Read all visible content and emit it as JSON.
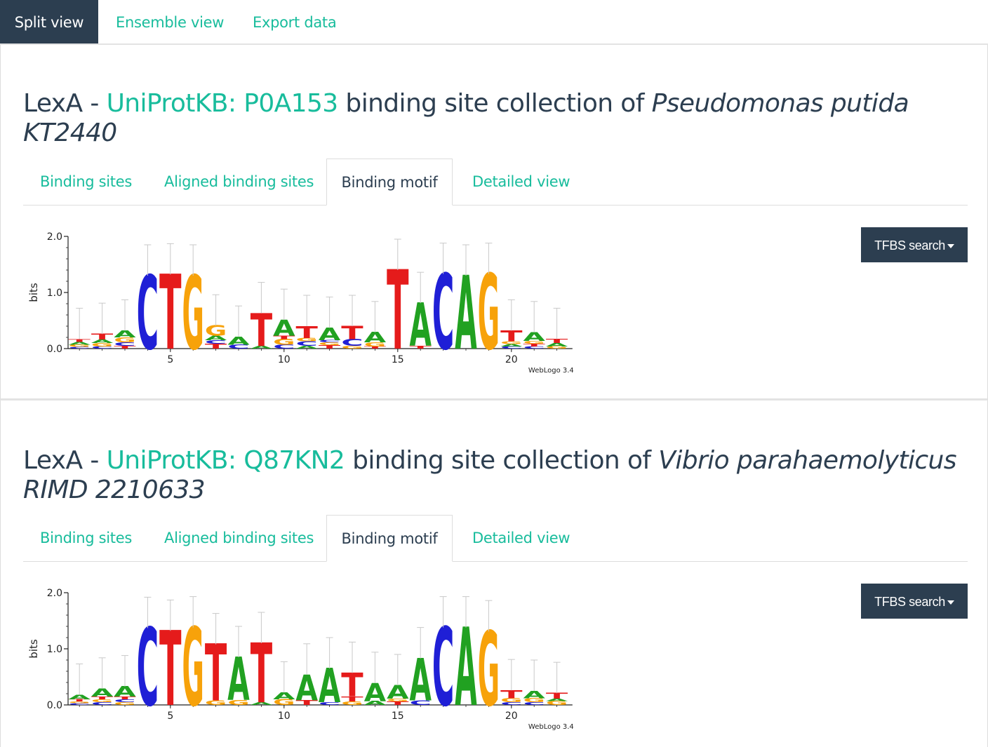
{
  "topnav": {
    "tabs": [
      {
        "label": "Split view",
        "active": true
      },
      {
        "label": "Ensemble view",
        "active": false
      },
      {
        "label": "Export data",
        "active": false
      }
    ]
  },
  "panels": [
    {
      "prefix": "LexA - ",
      "link": "UniProtKB: P0A153",
      "mid": " binding site collection of ",
      "organism": "Pseudomonas putida KT2440",
      "tabs": [
        "Binding sites",
        "Aligned binding sites",
        "Binding motif",
        "Detailed view"
      ],
      "active_tab": "Binding motif",
      "button": "TFBS search",
      "chart_data": {
        "type": "sequence-logo",
        "ylabel": "bits",
        "ylim": [
          0,
          2.0
        ],
        "y_ticks": [
          "0.0",
          "1.0",
          "2.0"
        ],
        "x_ticks": [
          "5",
          "10",
          "15",
          "20"
        ],
        "credit": "WebLogo 3.4",
        "positions": [
          [
            [
              "C",
              0.03
            ],
            [
              "G",
              0.04
            ],
            [
              "A",
              0.05
            ],
            [
              "T",
              0.05
            ]
          ],
          [
            [
              "C",
              0.04
            ],
            [
              "G",
              0.06
            ],
            [
              "A",
              0.06
            ],
            [
              "T",
              0.1
            ]
          ],
          [
            [
              "T",
              0.05
            ],
            [
              "C",
              0.06
            ],
            [
              "G",
              0.09
            ],
            [
              "A",
              0.12
            ]
          ],
          [
            [
              "C",
              1.3
            ]
          ],
          [
            [
              "T",
              1.32
            ]
          ],
          [
            [
              "G",
              1.3
            ]
          ],
          [
            [
              "T",
              0.09
            ],
            [
              "C",
              0.06
            ],
            [
              "A",
              0.08
            ],
            [
              "G",
              0.18
            ]
          ],
          [
            [
              "C",
              0.07
            ],
            [
              "A",
              0.14
            ]
          ],
          [
            [
              "A",
              0.05
            ],
            [
              "T",
              0.58
            ]
          ],
          [
            [
              "C",
              0.07
            ],
            [
              "G",
              0.1
            ],
            [
              "T",
              0.06
            ],
            [
              "A",
              0.28
            ]
          ],
          [
            [
              "A",
              0.05
            ],
            [
              "C",
              0.08
            ],
            [
              "G",
              0.06
            ],
            [
              "T",
              0.21
            ]
          ],
          [
            [
              "T",
              0.06
            ],
            [
              "G",
              0.05
            ],
            [
              "C",
              0.04
            ],
            [
              "A",
              0.22
            ]
          ],
          [
            [
              "G",
              0.05
            ],
            [
              "C",
              0.12
            ],
            [
              "T",
              0.23
            ]
          ],
          [
            [
              "T",
              0.04
            ],
            [
              "G",
              0.07
            ],
            [
              "A",
              0.18
            ]
          ],
          [
            [
              "T",
              1.4
            ]
          ],
          [
            [
              "T",
              0.05
            ],
            [
              "A",
              0.76
            ]
          ],
          [
            [
              "C",
              1.33
            ]
          ],
          [
            [
              "A",
              1.3
            ]
          ],
          [
            [
              "G",
              1.33
            ]
          ],
          [
            [
              "C",
              0.04
            ],
            [
              "A",
              0.04
            ],
            [
              "G",
              0.05
            ],
            [
              "T",
              0.19
            ]
          ],
          [
            [
              "C",
              0.04
            ],
            [
              "T",
              0.05
            ],
            [
              "G",
              0.05
            ],
            [
              "A",
              0.15
            ]
          ],
          [
            [
              "G",
              0.04
            ],
            [
              "A",
              0.06
            ],
            [
              "T",
              0.07
            ]
          ]
        ]
      }
    },
    {
      "prefix": "LexA - ",
      "link": "UniProtKB: Q87KN2",
      "mid": " binding site collection of ",
      "organism": "Vibrio parahaemolyticus RIMD 2210633",
      "tabs": [
        "Binding sites",
        "Aligned binding sites",
        "Binding motif",
        "Detailed view"
      ],
      "active_tab": "Binding motif",
      "button": "TFBS search",
      "chart_data": {
        "type": "sequence-logo",
        "ylabel": "bits",
        "ylim": [
          0,
          2.0
        ],
        "y_ticks": [
          "0.0",
          "1.0",
          "2.0"
        ],
        "x_ticks": [
          "5",
          "10",
          "15",
          "20"
        ],
        "credit": "WebLogo 3.4",
        "positions": [
          [
            [
              "C",
              0.03
            ],
            [
              "G",
              0.03
            ],
            [
              "T",
              0.04
            ],
            [
              "A",
              0.08
            ]
          ],
          [
            [
              "C",
              0.05
            ],
            [
              "G",
              0.05
            ],
            [
              "T",
              0.05
            ],
            [
              "A",
              0.14
            ]
          ],
          [
            [
              "G",
              0.05
            ],
            [
              "C",
              0.05
            ],
            [
              "T",
              0.05
            ],
            [
              "A",
              0.18
            ]
          ],
          [
            [
              "C",
              1.37
            ]
          ],
          [
            [
              "T",
              1.32
            ]
          ],
          [
            [
              "G",
              1.38
            ]
          ],
          [
            [
              "G",
              0.08
            ],
            [
              "T",
              1.0
            ]
          ],
          [
            [
              "G",
              0.09
            ],
            [
              "A",
              0.76
            ]
          ],
          [
            [
              "A",
              0.05
            ],
            [
              "T",
              1.05
            ]
          ],
          [
            [
              "G",
              0.1
            ],
            [
              "A",
              0.12
            ]
          ],
          [
            [
              "T",
              0.09
            ],
            [
              "A",
              0.45
            ]
          ],
          [
            [
              "C",
              0.05
            ],
            [
              "A",
              0.6
            ]
          ],
          [
            [
              "G",
              0.06
            ],
            [
              "T",
              0.09
            ],
            [
              "T",
              0.42
            ]
          ],
          [
            [
              "A",
              0.07
            ],
            [
              "A",
              0.32
            ]
          ],
          [
            [
              "T",
              0.06
            ],
            [
              "G",
              0.05
            ],
            [
              "A",
              0.24
            ]
          ],
          [
            [
              "C",
              0.08
            ],
            [
              "A",
              0.75
            ]
          ],
          [
            [
              "C",
              1.38
            ]
          ],
          [
            [
              "A",
              1.38
            ]
          ],
          [
            [
              "G",
              1.31
            ]
          ],
          [
            [
              "C",
              0.05
            ],
            [
              "G",
              0.07
            ],
            [
              "T",
              0.14
            ]
          ],
          [
            [
              "C",
              0.05
            ],
            [
              "G",
              0.07
            ],
            [
              "A",
              0.13
            ]
          ],
          [
            [
              "G",
              0.07
            ],
            [
              "A",
              0.04
            ],
            [
              "T",
              0.1
            ]
          ]
        ]
      }
    }
  ]
}
